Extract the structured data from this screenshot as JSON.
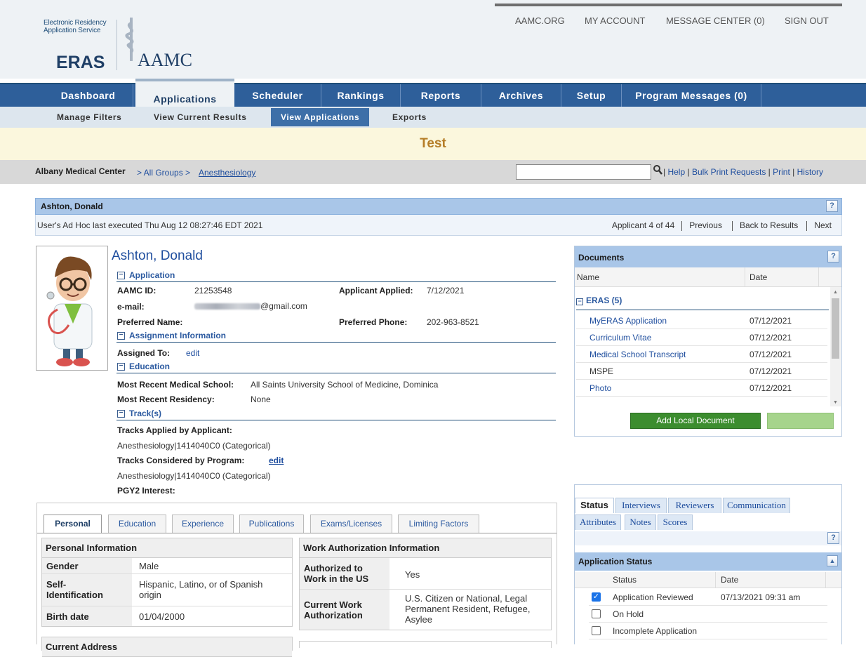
{
  "header": {
    "logo_ers_line1": "Electronic Residency",
    "logo_ers_line2": "Application Service",
    "logo_eras": "ERAS",
    "logo_aamc": "AAMC",
    "top_links": [
      "AAMC.ORG",
      "MY ACCOUNT",
      "MESSAGE CENTER (0)",
      "SIGN OUT"
    ]
  },
  "nav": {
    "tabs": [
      "Dashboard",
      "Applications",
      "Scheduler",
      "Rankings",
      "Reports",
      "Archives",
      "Setup",
      "Program Messages (0)"
    ],
    "active": "Applications",
    "subtabs": [
      "Manage Filters",
      "View Current Results",
      "View Applications",
      "Exports"
    ],
    "active_sub": "View Applications"
  },
  "page_title": "Test",
  "breadcrumb": {
    "org": "Albany Medical Center",
    "groups": "> All Groups >",
    "specialty": "Anesthesiology"
  },
  "search": {
    "value": ""
  },
  "toollinks": {
    "help": "Help",
    "bulk": "Bulk Print Requests",
    "print": "Print",
    "history": "History"
  },
  "applicant_bar": {
    "name": "Ashton, Donald",
    "adhoc": "User's Ad Hoc last executed Thu Aug 12 08:27:46 EDT 2021",
    "counter": "Applicant 4 of 44",
    "previous": "Previous",
    "back": "Back to Results",
    "next": "Next"
  },
  "applicant": {
    "full_name": "Ashton, Donald",
    "sections": {
      "application": "Application",
      "assignment": "Assignment Information",
      "education": "Education",
      "tracks": "Track(s)"
    },
    "aamc_id_label": "AAMC ID:",
    "aamc_id": "21253548",
    "applied_label": "Applicant Applied:",
    "applied": "7/12/2021",
    "email_label": "e-mail:",
    "email_suffix": "@gmail.com",
    "preferred_name_label": "Preferred Name:",
    "preferred_phone_label": "Preferred Phone:",
    "preferred_phone": "202-963-8521",
    "assigned_label": "Assigned To:",
    "assigned_edit": "edit",
    "med_school_label": "Most Recent Medical School:",
    "med_school": "All Saints University School of Medicine, Dominica",
    "residency_label": "Most Recent Residency:",
    "residency": "None",
    "tracks_applied_label": "Tracks Applied by Applicant:",
    "tracks_applied": "Anesthesiology|1414040C0 (Categorical)",
    "tracks_considered_label": "Tracks Considered by Program:",
    "tracks_considered_edit": "edit",
    "tracks_considered": "Anesthesiology|1414040C0 (Categorical)",
    "pgy2_label": "PGY2 Interest:"
  },
  "documents": {
    "title": "Documents",
    "col_name": "Name",
    "col_date": "Date",
    "group": "ERAS (5)",
    "items": [
      {
        "name": "MyERAS Application",
        "date": "07/12/2021",
        "link": true
      },
      {
        "name": "Curriculum Vitae",
        "date": "07/12/2021",
        "link": true
      },
      {
        "name": "Medical School Transcript",
        "date": "07/12/2021",
        "link": true
      },
      {
        "name": "MSPE",
        "date": "07/12/2021",
        "link": false
      },
      {
        "name": "Photo",
        "date": "07/12/2021",
        "link": true
      }
    ],
    "add_button": "Add Local Document"
  },
  "detail_tabs": [
    "Personal",
    "Education",
    "Experience",
    "Publications",
    "Exams/Licenses",
    "Limiting Factors"
  ],
  "personal": {
    "title": "Personal Information",
    "gender_label": "Gender",
    "gender": "Male",
    "self_id_label_1": "Self-",
    "self_id_label_2": "Identification",
    "self_id_1": "Hispanic, Latino, or of Spanish",
    "self_id_2": "origin",
    "birth_label": "Birth date",
    "birth": "01/04/2000",
    "current_addr": "Current Address"
  },
  "work": {
    "title": "Work Authorization Information",
    "auth_label_1": "Authorized to",
    "auth_label_2": "Work in the US",
    "auth": "Yes",
    "current_label_1": "Current Work",
    "current_label_2": "Authorization",
    "current_1": "U.S. Citizen or National, Legal",
    "current_2": "Permanent Resident, Refugee,",
    "current_3": "Asylee"
  },
  "status_panel": {
    "tabs_row1": [
      "Status",
      "Interviews",
      "Reviewers",
      "Communication"
    ],
    "tabs_row2": [
      "Attributes",
      "Notes",
      "Scores"
    ],
    "section_title": "Application Status",
    "col_status": "Status",
    "col_date": "Date",
    "rows": [
      {
        "name": "Application Reviewed",
        "date": "07/13/2021 09:31 am",
        "checked": true
      },
      {
        "name": "On Hold",
        "date": "",
        "checked": false
      },
      {
        "name": "Incomplete Application",
        "date": "",
        "checked": false
      }
    ]
  },
  "colors": {
    "nav_blue": "#2e5f9a",
    "title_gold": "#b57d27",
    "panel_header": "#a9c6e8",
    "button_green": "#3c8d2f"
  }
}
